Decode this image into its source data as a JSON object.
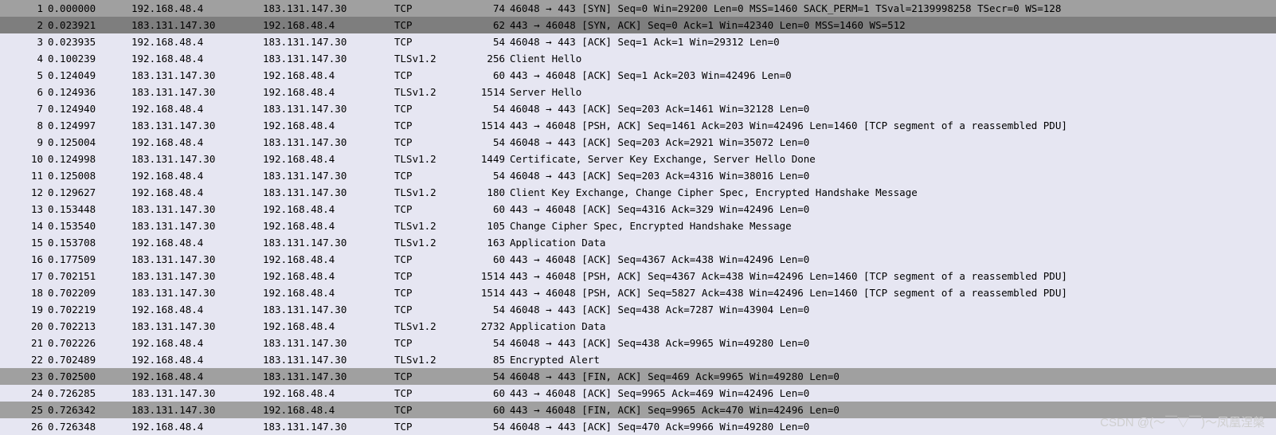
{
  "watermark": "CSDN @(～￣▽￣)～凤凰涅槃",
  "packets": [
    {
      "no": 1,
      "time": "0.000000",
      "src": "192.168.48.4",
      "dst": "183.131.147.30",
      "proto": "TCP",
      "len": 74,
      "info": "46048 → 443 [SYN] Seq=0 Win=29200 Len=0 MSS=1460 SACK_PERM=1 TSval=2139998258 TSecr=0 WS=128",
      "cls": "grey"
    },
    {
      "no": 2,
      "time": "0.023921",
      "src": "183.131.147.30",
      "dst": "192.168.48.4",
      "proto": "TCP",
      "len": 62,
      "info": "443 → 46048 [SYN, ACK] Seq=0 Ack=1 Win=42340 Len=0 MSS=1460 WS=512",
      "cls": "greydk"
    },
    {
      "no": 3,
      "time": "0.023935",
      "src": "192.168.48.4",
      "dst": "183.131.147.30",
      "proto": "TCP",
      "len": 54,
      "info": "46048 → 443 [ACK] Seq=1 Ack=1 Win=29312 Len=0",
      "cls": "tcp"
    },
    {
      "no": 4,
      "time": "0.100239",
      "src": "192.168.48.4",
      "dst": "183.131.147.30",
      "proto": "TLSv1.2",
      "len": 256,
      "info": "Client Hello",
      "cls": "tls"
    },
    {
      "no": 5,
      "time": "0.124049",
      "src": "183.131.147.30",
      "dst": "192.168.48.4",
      "proto": "TCP",
      "len": 60,
      "info": "443 → 46048 [ACK] Seq=1 Ack=203 Win=42496 Len=0",
      "cls": "tcp"
    },
    {
      "no": 6,
      "time": "0.124936",
      "src": "183.131.147.30",
      "dst": "192.168.48.4",
      "proto": "TLSv1.2",
      "len": 1514,
      "info": "Server Hello",
      "cls": "tls"
    },
    {
      "no": 7,
      "time": "0.124940",
      "src": "192.168.48.4",
      "dst": "183.131.147.30",
      "proto": "TCP",
      "len": 54,
      "info": "46048 → 443 [ACK] Seq=203 Ack=1461 Win=32128 Len=0",
      "cls": "tcp"
    },
    {
      "no": 8,
      "time": "0.124997",
      "src": "183.131.147.30",
      "dst": "192.168.48.4",
      "proto": "TCP",
      "len": 1514,
      "info": "443 → 46048 [PSH, ACK] Seq=1461 Ack=203 Win=42496 Len=1460 [TCP segment of a reassembled PDU]",
      "cls": "tcp"
    },
    {
      "no": 9,
      "time": "0.125004",
      "src": "192.168.48.4",
      "dst": "183.131.147.30",
      "proto": "TCP",
      "len": 54,
      "info": "46048 → 443 [ACK] Seq=203 Ack=2921 Win=35072 Len=0",
      "cls": "tcp"
    },
    {
      "no": 10,
      "time": "0.124998",
      "src": "183.131.147.30",
      "dst": "192.168.48.4",
      "proto": "TLSv1.2",
      "len": 1449,
      "info": "Certificate, Server Key Exchange, Server Hello Done",
      "cls": "tls"
    },
    {
      "no": 11,
      "time": "0.125008",
      "src": "192.168.48.4",
      "dst": "183.131.147.30",
      "proto": "TCP",
      "len": 54,
      "info": "46048 → 443 [ACK] Seq=203 Ack=4316 Win=38016 Len=0",
      "cls": "tcp"
    },
    {
      "no": 12,
      "time": "0.129627",
      "src": "192.168.48.4",
      "dst": "183.131.147.30",
      "proto": "TLSv1.2",
      "len": 180,
      "info": "Client Key Exchange, Change Cipher Spec, Encrypted Handshake Message",
      "cls": "tls"
    },
    {
      "no": 13,
      "time": "0.153448",
      "src": "183.131.147.30",
      "dst": "192.168.48.4",
      "proto": "TCP",
      "len": 60,
      "info": "443 → 46048 [ACK] Seq=4316 Ack=329 Win=42496 Len=0",
      "cls": "tcp"
    },
    {
      "no": 14,
      "time": "0.153540",
      "src": "183.131.147.30",
      "dst": "192.168.48.4",
      "proto": "TLSv1.2",
      "len": 105,
      "info": "Change Cipher Spec, Encrypted Handshake Message",
      "cls": "tls"
    },
    {
      "no": 15,
      "time": "0.153708",
      "src": "192.168.48.4",
      "dst": "183.131.147.30",
      "proto": "TLSv1.2",
      "len": 163,
      "info": "Application Data",
      "cls": "tls"
    },
    {
      "no": 16,
      "time": "0.177509",
      "src": "183.131.147.30",
      "dst": "192.168.48.4",
      "proto": "TCP",
      "len": 60,
      "info": "443 → 46048 [ACK] Seq=4367 Ack=438 Win=42496 Len=0",
      "cls": "tcp"
    },
    {
      "no": 17,
      "time": "0.702151",
      "src": "183.131.147.30",
      "dst": "192.168.48.4",
      "proto": "TCP",
      "len": 1514,
      "info": "443 → 46048 [PSH, ACK] Seq=4367 Ack=438 Win=42496 Len=1460 [TCP segment of a reassembled PDU]",
      "cls": "tcp"
    },
    {
      "no": 18,
      "time": "0.702209",
      "src": "183.131.147.30",
      "dst": "192.168.48.4",
      "proto": "TCP",
      "len": 1514,
      "info": "443 → 46048 [PSH, ACK] Seq=5827 Ack=438 Win=42496 Len=1460 [TCP segment of a reassembled PDU]",
      "cls": "tcp"
    },
    {
      "no": 19,
      "time": "0.702219",
      "src": "192.168.48.4",
      "dst": "183.131.147.30",
      "proto": "TCP",
      "len": 54,
      "info": "46048 → 443 [ACK] Seq=438 Ack=7287 Win=43904 Len=0",
      "cls": "tcp"
    },
    {
      "no": 20,
      "time": "0.702213",
      "src": "183.131.147.30",
      "dst": "192.168.48.4",
      "proto": "TLSv1.2",
      "len": 2732,
      "info": "Application Data",
      "cls": "tls"
    },
    {
      "no": 21,
      "time": "0.702226",
      "src": "192.168.48.4",
      "dst": "183.131.147.30",
      "proto": "TCP",
      "len": 54,
      "info": "46048 → 443 [ACK] Seq=438 Ack=9965 Win=49280 Len=0",
      "cls": "tcp"
    },
    {
      "no": 22,
      "time": "0.702489",
      "src": "192.168.48.4",
      "dst": "183.131.147.30",
      "proto": "TLSv1.2",
      "len": 85,
      "info": "Encrypted Alert",
      "cls": "tls"
    },
    {
      "no": 23,
      "time": "0.702500",
      "src": "192.168.48.4",
      "dst": "183.131.147.30",
      "proto": "TCP",
      "len": 54,
      "info": "46048 → 443 [FIN, ACK] Seq=469 Ack=9965 Win=49280 Len=0",
      "cls": "grey"
    },
    {
      "no": 24,
      "time": "0.726285",
      "src": "183.131.147.30",
      "dst": "192.168.48.4",
      "proto": "TCP",
      "len": 60,
      "info": "443 → 46048 [ACK] Seq=9965 Ack=469 Win=42496 Len=0",
      "cls": "tcp"
    },
    {
      "no": 25,
      "time": "0.726342",
      "src": "183.131.147.30",
      "dst": "192.168.48.4",
      "proto": "TCP",
      "len": 60,
      "info": "443 → 46048 [FIN, ACK] Seq=9965 Ack=470 Win=42496 Len=0",
      "cls": "grey"
    },
    {
      "no": 26,
      "time": "0.726348",
      "src": "192.168.48.4",
      "dst": "183.131.147.30",
      "proto": "TCP",
      "len": 54,
      "info": "46048 → 443 [ACK] Seq=470 Ack=9966 Win=49280 Len=0",
      "cls": "tcp"
    }
  ]
}
